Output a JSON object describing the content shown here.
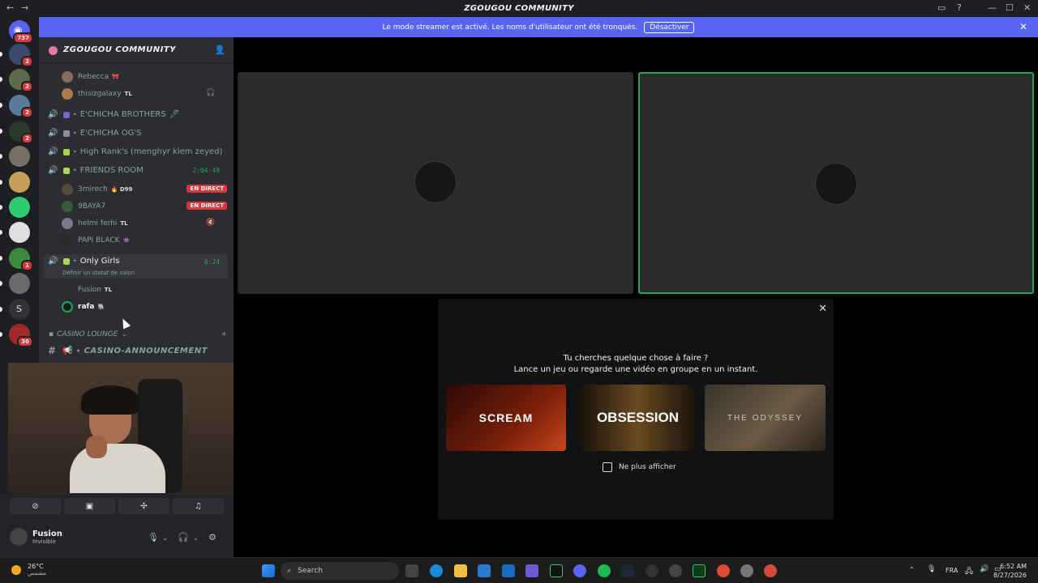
{
  "window": {
    "title": "ZGOUGOU COMMUNITY"
  },
  "banner": {
    "text": "Le mode streamer est activé. Les noms d'utilisateur ont été tronqués.",
    "button": "Désactiver"
  },
  "rail": {
    "home_badge": "737",
    "servers": [
      {
        "badge": "2",
        "color": "#3a4a6a"
      },
      {
        "badge": "2",
        "color": "#5a6a4a"
      },
      {
        "badge": "2",
        "color": "#5a7a9a"
      },
      {
        "badge": "2",
        "color": "#2a3a2a"
      },
      {
        "badge": "",
        "color": "#7a7066"
      },
      {
        "badge": "",
        "color": "#c9a05a"
      },
      {
        "badge": "",
        "color": "#2ecc71"
      },
      {
        "badge": "",
        "color": "#e0e0e0"
      },
      {
        "badge": "1",
        "color": "#3a8a3a"
      },
      {
        "badge": "",
        "color": "#6a6a6a"
      },
      {
        "badge": "",
        "color": "#313338",
        "letter": "S"
      },
      {
        "badge": "36",
        "color": "#a02a2a"
      }
    ]
  },
  "server": {
    "name": "ZGOUGOU COMMUNITY"
  },
  "channels": {
    "top_users": [
      {
        "name": "Rebecca",
        "tag": "🎀"
      },
      {
        "name": "thisizgalaxy",
        "tag": "TL"
      }
    ],
    "voice": [
      {
        "name": "E'CHICHA BROTHERS",
        "suffix": "🖊"
      },
      {
        "name": "E'CHICHA OG'S",
        "suffix": ""
      },
      {
        "name": "High Rank's (menghyr klem zeyed)",
        "suffix": ""
      },
      {
        "name": "FRIENDS ROOM",
        "timer": "2:04:48"
      }
    ],
    "friends_users": [
      {
        "name": "3mirech",
        "tag": "🔥 D99",
        "live": "EN DIRECT"
      },
      {
        "name": "9BAYA7",
        "tag": "",
        "live": "EN DIRECT"
      },
      {
        "name": "helmi ferhi",
        "tag": "TL",
        "live": ""
      },
      {
        "name": "PAPI BLACK",
        "tag": "👾",
        "live": ""
      }
    ],
    "only_girls": {
      "name": "Only Girls",
      "timer": "0:24",
      "status": "Définir un statut de salon"
    },
    "only_girls_users": [
      {
        "name": "Fusion",
        "tag": "TL"
      },
      {
        "name": "rafa",
        "tag": "🐘"
      }
    ],
    "category": "CASINO LOUNGE",
    "text_channel": "CASINO-ANNOUNCEMENT"
  },
  "user_panel": {
    "name": "Fusion",
    "status": "Invisible"
  },
  "activity": {
    "line1": "Tu cherches quelque chose à faire ?",
    "line2": "Lance un jeu ou regarde une vidéo en groupe en un instant.",
    "cards": [
      "SCREAM",
      "OBSESSION",
      "THE ODYSSEY"
    ],
    "checkbox": "Ne plus afficher"
  },
  "taskbar": {
    "weather_temp": "26°C",
    "weather_desc": "مشمس",
    "search": "Search",
    "lang": "FRA",
    "time": "6:52 AM",
    "date": "8/27/2026"
  },
  "colors": {
    "accent": "#5865f2",
    "live": "#da373c",
    "online": "#23a55a"
  }
}
